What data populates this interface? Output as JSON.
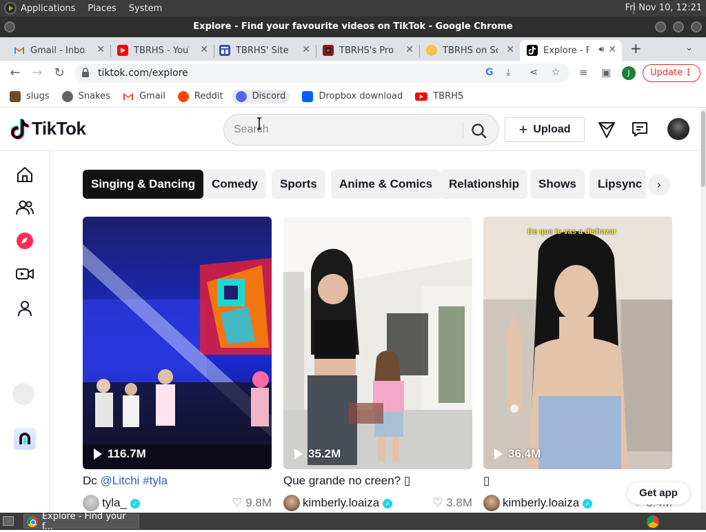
{
  "os": {
    "menus": [
      "Applications",
      "Places",
      "System"
    ],
    "clock": "Fri Nov 10, 12:21"
  },
  "window": {
    "title": "Explore - Find your favourite videos on TikTok - Google Chrome"
  },
  "tabs": [
    {
      "title": "Gmail - Inbox",
      "icon": "gmail-icon"
    },
    {
      "title": "TBRHS - YouTu",
      "icon": "youtube-icon"
    },
    {
      "title": "TBRHS' Site fo",
      "icon": "site-icon"
    },
    {
      "title": "TBRHS's Profil",
      "icon": "profile-icon"
    },
    {
      "title": "TBRHS on Scra",
      "icon": "scratch-icon"
    },
    {
      "title": "Explore - F",
      "icon": "tiktok-icon",
      "active": true
    }
  ],
  "toolbar": {
    "url": "tiktok.com/explore",
    "update_label": "Update",
    "profile_initial": "J"
  },
  "bookmarks": [
    {
      "label": "slugs",
      "icon": "slug-icon"
    },
    {
      "label": "Snakes",
      "icon": "globe-icon"
    },
    {
      "label": "Gmail",
      "icon": "gmail-icon"
    },
    {
      "label": "Reddit",
      "icon": "reddit-icon"
    },
    {
      "label": "Discord",
      "icon": "discord-icon"
    },
    {
      "label": "Dropbox download",
      "icon": "dropbox-icon"
    },
    {
      "label": "TBRHS",
      "icon": "youtube-icon"
    }
  ],
  "tiktok": {
    "logo_text": "TikTok",
    "search_placeholder": "Search",
    "upload_label": "Upload",
    "get_app_label": "Get app",
    "categories": [
      "Singing & Dancing",
      "Comedy",
      "Sports",
      "Anime & Comics",
      "Relationship",
      "Shows",
      "Lipsync"
    ],
    "active_category": "Singing & Dancing",
    "videos": [
      {
        "views": "116.7M",
        "caption_plain": "Dc ",
        "caption_tags": "@Litchi #tyla",
        "author": "tyla_",
        "verified": true,
        "likes": "9.8M"
      },
      {
        "views": "35.2M",
        "caption_plain": "Que grande no creen? ▯",
        "caption_tags": "",
        "author": "kimberly.loaiza",
        "verified": true,
        "likes": "3.8M"
      },
      {
        "views": "36.4M",
        "caption_plain": "▯",
        "caption_tags": "",
        "author": "kimberly.loaiza",
        "verified": true,
        "likes": "3.4M",
        "overlay_text": "De que te vas a disfrazar"
      }
    ]
  },
  "taskbar": {
    "window_label": "Explore - Find your f..."
  }
}
